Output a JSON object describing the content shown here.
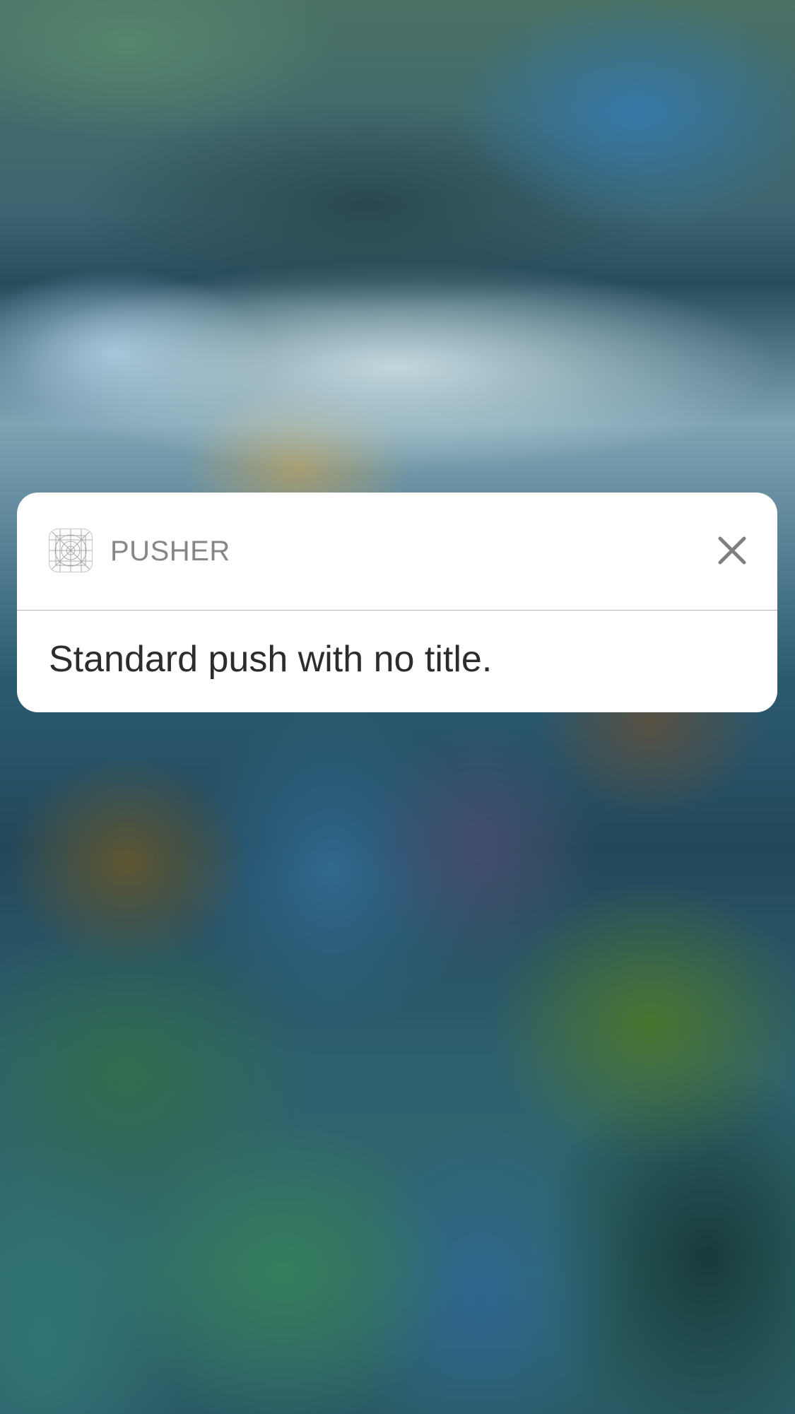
{
  "notification": {
    "app_name": "PUSHER",
    "app_icon": "app-template-grid-icon",
    "close_icon": "close-icon",
    "message": "Standard push with no title."
  }
}
